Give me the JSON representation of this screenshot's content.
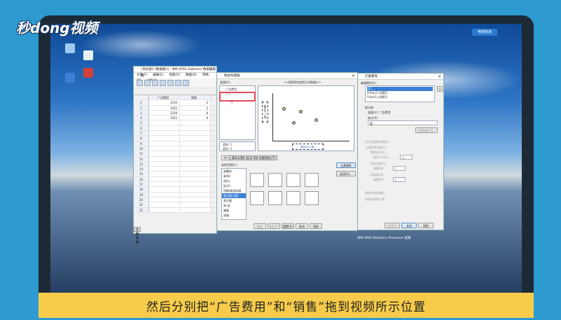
{
  "logo_text": "秒dong视频",
  "caption": "然后分别把“广告费用”和“销售”拖到视频所示位置",
  "desktop_button": "电脑管家",
  "spss_window": {
    "title": "*未标题1 [数据集0] - IBM SPSS Statistics 数据编辑器",
    "menus": [
      "文件(F)",
      "编辑(E)",
      "视图(V)",
      "数据(D)",
      "转换(T)",
      "分析(A)"
    ],
    "columns": [
      "广告费用",
      "销售"
    ],
    "rows": [
      {
        "n": "1",
        "a": "1230",
        "b": "2"
      },
      {
        "n": "2",
        "a": "1452",
        "b": "2"
      },
      {
        "n": "3",
        "a": "1236",
        "b": "8"
      },
      {
        "n": "4",
        "a": "1452",
        "b": "6"
      },
      {
        "n": "5",
        "a": "",
        "b": ""
      },
      {
        "n": "6",
        "a": "",
        "b": ""
      },
      {
        "n": "7",
        "a": "",
        "b": ""
      },
      {
        "n": "8",
        "a": "",
        "b": ""
      },
      {
        "n": "9",
        "a": "",
        "b": ""
      },
      {
        "n": "10",
        "a": "",
        "b": ""
      },
      {
        "n": "11",
        "a": "",
        "b": ""
      },
      {
        "n": "12",
        "a": "",
        "b": ""
      },
      {
        "n": "13",
        "a": "",
        "b": ""
      },
      {
        "n": "14",
        "a": "",
        "b": ""
      },
      {
        "n": "15",
        "a": "",
        "b": ""
      },
      {
        "n": "16",
        "a": "",
        "b": ""
      },
      {
        "n": "17",
        "a": "",
        "b": ""
      },
      {
        "n": "18",
        "a": "",
        "b": ""
      },
      {
        "n": "19",
        "a": "",
        "b": ""
      },
      {
        "n": "20",
        "a": "",
        "b": ""
      },
      {
        "n": "21",
        "a": "",
        "b": ""
      },
      {
        "n": "22",
        "a": "",
        "b": ""
      }
    ],
    "view_tabs": [
      "数据视图",
      "变量视图"
    ],
    "status": "IBM SPSS Statistics Processor 就绪"
  },
  "chart_builder": {
    "title": "图表构建器",
    "variables_label": "变量(V):",
    "vars": [
      "广告费用",
      "销售"
    ],
    "canvas_hint": "<<图表预览使用示例数据>>",
    "x_drop": "是否为 X 轴?",
    "y_drop": "是否为 Y 轴?",
    "filter_items": [
      "类别: 1",
      "类别: 2"
    ],
    "tabs": [
      "库(L)",
      "基本元素(B)",
      "组/点 ID(G)",
      "标题/脚注(T)"
    ],
    "select_from": "选择范围(C):",
    "gallery_items": [
      "收藏夹",
      "条(B)",
      "线(L)",
      "区(A)",
      "饼图/极坐标图",
      "散点图/点图",
      "直方图",
      "高-低",
      "箱图",
      "双轴"
    ],
    "side_buttons": [
      "元素属性",
      "选项(O)..."
    ],
    "bottom_buttons": [
      "确定",
      "粘贴(P)",
      "重置(R)",
      "取消",
      "帮助"
    ]
  },
  "element_props": {
    "title": "元素属性",
    "edit_props_label": "编辑属性(E):",
    "list_items": [
      "点1",
      "X-Axis1 (点图1)",
      "Y-Axis1 (点图1)"
    ],
    "var_label": "统计量",
    "var_value": "变量(V):  广告费用",
    "stat_label": "统计(S):",
    "stat_value": "值",
    "set_params": "设置参数(T)...",
    "error_bars": "显示误差条形图(E)",
    "interval_label": "误差条形图表示",
    "ci": "置信区间(C)",
    "level": "级别 (%)(L):",
    "level_value": "95",
    "se": "标准误差(A)",
    "mult1": "乘数(M):",
    "mult1_value": "2",
    "sd": "标准差(D)",
    "mult2": "乘数(M):",
    "mult2_value": "2",
    "check1": "将样本用作随机",
    "check2": "仅使用有效个案",
    "buttons": [
      "应用(A)",
      "关闭",
      "帮助"
    ]
  }
}
